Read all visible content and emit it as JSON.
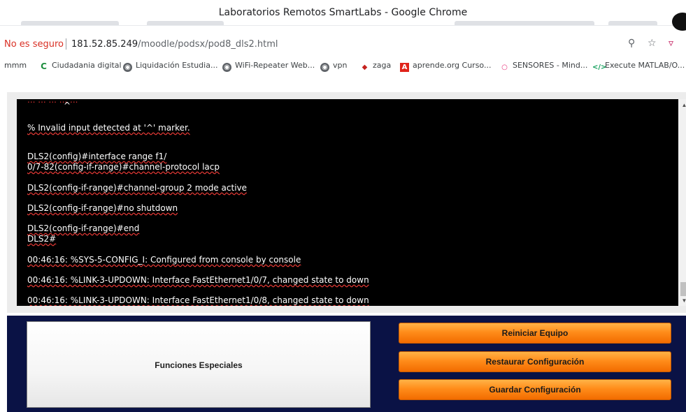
{
  "browser": {
    "window_title": "Laboratorios Remotos SmartLabs - Google Chrome",
    "security_label": "No es seguro",
    "url_host": "181.52.85.249",
    "url_path": "/moodle/podsx/pod8_dls2.html"
  },
  "bookmarks": [
    {
      "label": "mmm",
      "icon": "none"
    },
    {
      "label": "Ciudadania digital",
      "icon": "ciudadania-icon"
    },
    {
      "label": "Liquidación Estudia...",
      "icon": "globe-icon"
    },
    {
      "label": "WiFi-Repeater Web...",
      "icon": "globe-icon"
    },
    {
      "label": "vpn",
      "icon": "globe-icon"
    },
    {
      "label": "zaga",
      "icon": "zaga-icon"
    },
    {
      "label": "aprende.org Curso...",
      "icon": "adobe-icon"
    },
    {
      "label": "SENSORES - Mind...",
      "icon": "sensores-icon"
    },
    {
      "label": "Execute MATLAB/O...",
      "icon": "code-icon"
    }
  ],
  "terminal": {
    "cut_top": "...  ...  ...  ...  ...",
    "lines": [
      "^",
      "% Invalid input detected at '^' marker.",
      "DLS2(config)#interface range f1/",
      "0/7-82(config-if-range)#channel-protocol lacp",
      "DLS2(config-if-range)#channel-group 2 mode active",
      "DLS2(config-if-range)#no shutdown",
      "DLS2(config-if-range)#end",
      "DLS2#",
      "00:46:16: %SYS-5-CONFIG_I: Configured from console by console",
      "00:46:16: %LINK-3-UPDOWN: Interface FastEthernet1/0/7, changed state to down",
      "00:46:16: %LINK-3-UPDOWN: Interface FastEthernet1/0/8, changed state to down"
    ]
  },
  "panel": {
    "special_functions": "Funciones Especiales",
    "reset_button": "Reiniciar Equipo",
    "restore_button": "Restaurar Configuración",
    "save_button": "Guardar Configuración"
  },
  "colors": {
    "terminal_bg": "#000000",
    "panel_bg": "#0a1245",
    "button_orange": "#ff8c1a",
    "insecure_red": "#d93025"
  }
}
